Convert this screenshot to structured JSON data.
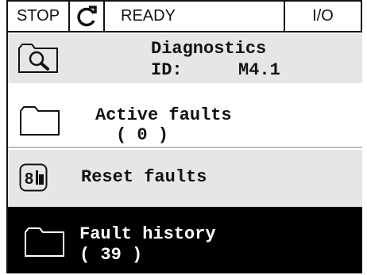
{
  "statusbar": {
    "stop": "STOP",
    "rotation_icon": "rotation-arrow-icon",
    "state": "READY",
    "io": "I/O"
  },
  "header": {
    "icon": "magnifier-icon",
    "title": "Diagnostics",
    "id_label": "ID:",
    "id_value": "M4.1"
  },
  "menu": {
    "active_faults": {
      "icon": "folder-icon",
      "label": "Active faults",
      "count": "( 0 )"
    },
    "reset_faults": {
      "icon": "reset-parameters-icon",
      "label": "Reset faults"
    },
    "fault_history": {
      "icon": "folder-icon",
      "label": "Fault history",
      "count": "( 39 )",
      "selected": true
    }
  },
  "colors": {
    "header_bg": "#e6e6e6",
    "selected_bg": "#000000",
    "selected_text": "#ffffff",
    "text": "#111111"
  }
}
